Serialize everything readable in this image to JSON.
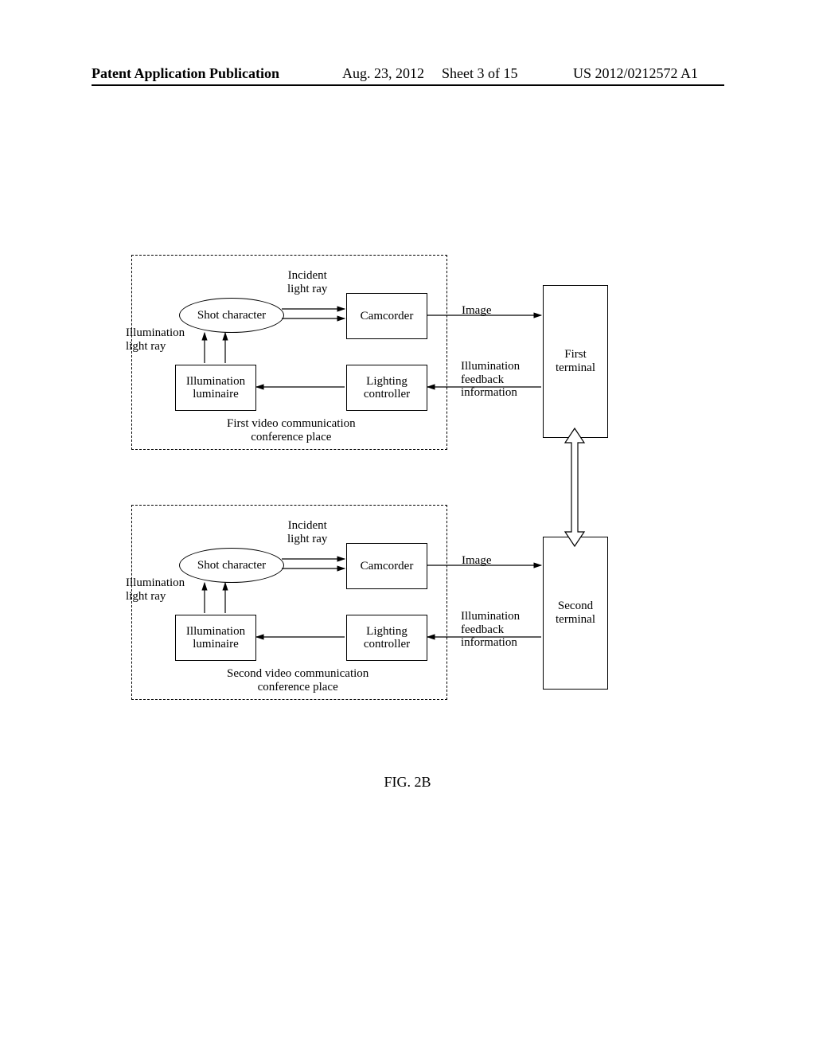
{
  "header": {
    "left": "Patent Application Publication",
    "date": "Aug. 23, 2012",
    "sheet": "Sheet 3 of 15",
    "pubno": "US 2012/0212572 A1"
  },
  "figure": {
    "caption": "FIG. 2B"
  },
  "common_labels": {
    "incident_light_ray": "Incident\nlight ray",
    "illumination_light_ray": "Illumination\nlight ray",
    "image": "Image",
    "illumination_feedback": "Illumination\nfeedback\ninformation"
  },
  "blocks": {
    "shot_character": "Shot character",
    "camcorder": "Camcorder",
    "illumination_luminaire": "Illumination\nluminaire",
    "lighting_controller": "Lighting\ncontroller"
  },
  "conference": {
    "first_label": "First video communication\nconference place",
    "second_label": "Second video communication\nconference place"
  },
  "terminals": {
    "first": "First\nterminal",
    "second": "Second\nterminal"
  }
}
